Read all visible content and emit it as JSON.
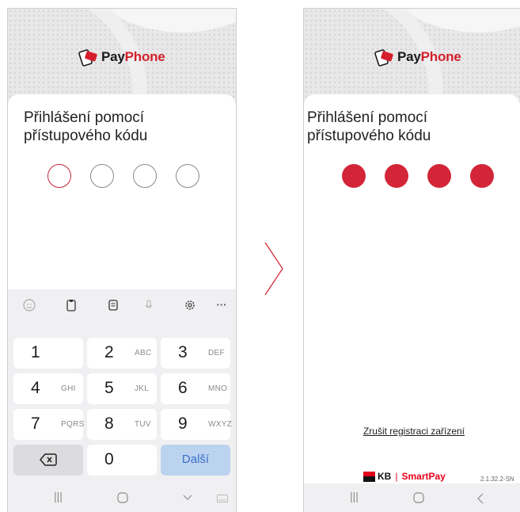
{
  "brand": {
    "part1": "Pay",
    "part2": "Phone",
    "accent_color": "#d4202c"
  },
  "title": "Přihlášení pomocí přístupového kódu",
  "left": {
    "pin_states": [
      "active",
      "empty",
      "empty",
      "empty"
    ],
    "keyboard": {
      "toolbar_icons": [
        "emoji-icon",
        "clipboard-icon",
        "text-edit-icon",
        "microphone-icon",
        "settings-icon",
        "more-icon"
      ],
      "keys": [
        {
          "num": "1",
          "letters": ""
        },
        {
          "num": "2",
          "letters": "ABC"
        },
        {
          "num": "3",
          "letters": "DEF"
        },
        {
          "num": "4",
          "letters": "GHI"
        },
        {
          "num": "5",
          "letters": "JKL"
        },
        {
          "num": "6",
          "letters": "MNO"
        },
        {
          "num": "7",
          "letters": "PQRS"
        },
        {
          "num": "8",
          "letters": "TUV"
        },
        {
          "num": "9",
          "letters": "WXYZ"
        }
      ],
      "zero": "0",
      "next_label": "Další",
      "backspace_icon": "backspace-icon"
    }
  },
  "right": {
    "pin_states": [
      "filled",
      "filled",
      "filled",
      "filled"
    ],
    "cancel_registration": "Zrušit registraci zařízení",
    "footer_kb": "KB",
    "footer_sep": "|",
    "footer_smart": "SmartPay",
    "version": "2.1.32.2-SN"
  }
}
